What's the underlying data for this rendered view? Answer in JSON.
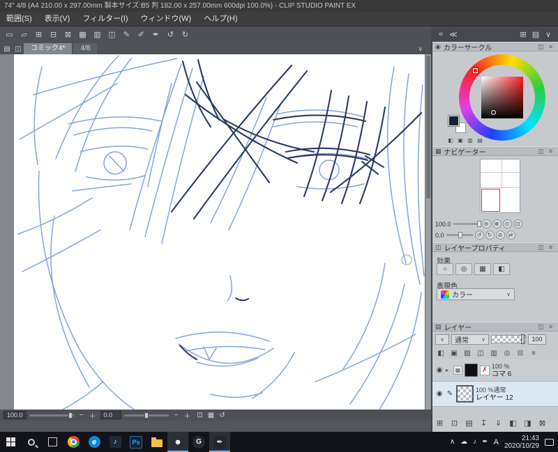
{
  "title_bar": {
    "title": "74\" 4/8 (A4 210.00 x 297.00mm 製本サイズ:B5 判 182.00 x 257.00mm 600dpi 100.0%) - CLIP STUDIO PAINT EX"
  },
  "menu": {
    "items": [
      "範囲(S)",
      "表示(V)",
      "フィルター(I)",
      "ウィンドウ(W)",
      "ヘルプ(H)"
    ]
  },
  "toolbar": {
    "icons": [
      {
        "n": "selection-rect-icon",
        "g": "▭"
      },
      {
        "n": "selection-lasso-icon",
        "g": "▱"
      },
      {
        "n": "selection-add-icon",
        "g": "⊞"
      },
      {
        "n": "selection-subtract-icon",
        "g": "⊟"
      },
      {
        "n": "deselect-icon",
        "g": "⊠"
      },
      {
        "n": "grid-icon",
        "g": "▦"
      },
      {
        "n": "ruler-icon",
        "g": "▥"
      },
      {
        "n": "snap-ruler-icon",
        "g": "◫"
      },
      {
        "n": "pen-curve-icon",
        "g": "✎"
      },
      {
        "n": "pen-line-icon",
        "g": "✐"
      },
      {
        "n": "pen-vector-icon",
        "g": "✒"
      },
      {
        "n": "rotate-left-icon",
        "g": "↺"
      },
      {
        "n": "rotate-right-icon",
        "g": "↻"
      }
    ]
  },
  "minibar": {
    "left": [
      {
        "n": "collapse-all-icon",
        "g": "«"
      },
      {
        "n": "collapse-panel-icon",
        "g": "≪"
      }
    ],
    "right": [
      {
        "n": "workspace-icon",
        "g": "⊞"
      },
      {
        "n": "panel-list-icon",
        "g": "▤"
      },
      {
        "n": "panel-caret-icon",
        "g": "∨"
      }
    ]
  },
  "panel_header_icons": [
    {
      "n": "panel-dock-icon",
      "g": "◫"
    },
    {
      "n": "panel-menu-icon",
      "g": "≡"
    }
  ],
  "doc": {
    "tab_icons": [
      {
        "n": "page-manager-icon",
        "g": "▤"
      },
      {
        "n": "subview-icon",
        "g": "◫"
      }
    ],
    "tabs": [
      {
        "label": "コミック4*"
      },
      {
        "label": "4/8"
      }
    ],
    "status": {
      "zoom": "100.0",
      "rotation": "0.0"
    },
    "status_controls": [
      {
        "n": "zoom-out-button",
        "g": "−"
      },
      {
        "n": "zoom-in-button",
        "g": "＋"
      }
    ],
    "status_icons": [
      {
        "n": "fit-to-screen-icon",
        "g": "⊡"
      },
      {
        "n": "actual-size-icon",
        "g": "▦"
      },
      {
        "n": "reset-rotate-icon",
        "g": "↺"
      }
    ]
  },
  "color_panel": {
    "icon": "◉",
    "title": "カラーサークル",
    "swatch_icons": [
      {
        "n": "color-history-icon",
        "g": "◧"
      },
      {
        "n": "approx-color-icon",
        "g": "▣"
      },
      {
        "n": "intermediate-color-icon",
        "g": "▥"
      },
      {
        "n": "color-set-icon",
        "g": "▤"
      }
    ]
  },
  "navigator": {
    "icon": "▦",
    "title": "ナビゲーター",
    "zoom": "100.0",
    "rotation": "0.0",
    "zoom_buttons": [
      {
        "n": "zoom-out-icon",
        "g": "⊖"
      },
      {
        "n": "zoom-in-icon",
        "g": "⊕"
      },
      {
        "n": "zoom-100-icon",
        "g": "⊙"
      },
      {
        "n": "fit-icon",
        "g": "⊡"
      }
    ],
    "rotate_buttons": [
      {
        "n": "rotate-left-icon",
        "g": "↺"
      },
      {
        "n": "rotate-right-icon",
        "g": "↻"
      },
      {
        "n": "reset-rotation-icon",
        "g": "⊘"
      },
      {
        "n": "flip-horizontal-icon",
        "g": "⇄"
      }
    ]
  },
  "layer_property": {
    "icon": "◫",
    "title": "レイヤープロパティ",
    "effect_label": "効果",
    "expression_label": "表現色",
    "expression_value": "カラー",
    "effect_icons": [
      {
        "n": "border-effect-icon",
        "g": "○"
      },
      {
        "n": "tone-effect-icon",
        "g": "◎"
      },
      {
        "n": "halftone-icon",
        "g": "▦"
      },
      {
        "n": "extract-line-icon",
        "g": "◧"
      }
    ]
  },
  "layer_panel": {
    "icon": "▤",
    "title": "レイヤー",
    "blend_mode": "通常",
    "opacity": "100",
    "mid_icons": [
      {
        "n": "clip-at-layer-icon",
        "g": "◧"
      },
      {
        "n": "lock-layer-icon",
        "g": "▣"
      },
      {
        "n": "lock-transparent-icon",
        "g": "▨"
      },
      {
        "n": "enable-mask-icon",
        "g": "◫"
      },
      {
        "n": "set-ruler-icon",
        "g": "▥"
      },
      {
        "n": "onion-skin-icon",
        "g": "◎"
      },
      {
        "n": "two-pane-icon",
        "g": "⊟"
      },
      {
        "n": "palette-menu-icon",
        "g": "≡"
      }
    ],
    "rows": [
      {
        "info": "100 %",
        "name": "コマ 6"
      },
      {
        "info": "100 %通常",
        "name": "レイヤー 12"
      }
    ],
    "bottom_icons": [
      {
        "n": "new-raster-layer-icon",
        "g": "⊞"
      },
      {
        "n": "new-vector-layer-icon",
        "g": "⊡"
      },
      {
        "n": "new-layer-folder-icon",
        "g": "▤"
      },
      {
        "n": "transfer-layer-icon",
        "g": "↧"
      },
      {
        "n": "combine-layer-icon",
        "g": "⇓"
      },
      {
        "n": "create-mask-icon",
        "g": "◧"
      },
      {
        "n": "apply-mask-icon",
        "g": "◨"
      },
      {
        "n": "delete-layer-icon",
        "g": "⊠"
      }
    ]
  },
  "misc": {
    "eye": "◉",
    "pen": "✎",
    "arrow": "▸",
    "caret": "∨",
    "x_badge": "✗",
    "grid": "▦"
  },
  "taskbar": {
    "glyphs": {
      "edge": "e",
      "media": "♪",
      "ps": "Ps",
      "discord": "☻",
      "clip_g": "G",
      "paint_pen": "✒"
    },
    "tray_icons": [
      {
        "n": "hidden-icons-chevron",
        "g": "∧"
      },
      {
        "n": "onedrive-icon",
        "g": "☁"
      },
      {
        "n": "volume-icon",
        "g": "♪"
      },
      {
        "n": "tablet-pen-icon",
        "g": "✒"
      }
    ],
    "ime": "A",
    "time": "21:43",
    "date": "2020/10/29"
  },
  "colors": {
    "accent": "#76b9ed",
    "sketch_blue": "#7fa0d8",
    "sketch_dark": "#2b3a62",
    "foreground": "#181f38"
  }
}
